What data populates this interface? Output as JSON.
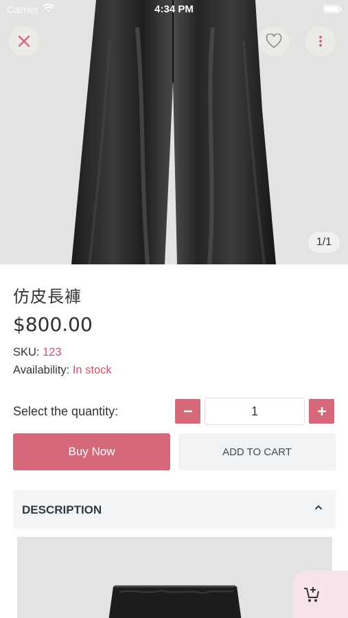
{
  "status_bar": {
    "carrier": "Carrier",
    "time": "4:34 PM"
  },
  "gallery": {
    "counter": "1/1"
  },
  "product": {
    "name": "仿皮長褲",
    "price": "$800.00",
    "sku_label": "SKU:",
    "sku_value": "123",
    "availability_label": "Availability:",
    "availability_value": "In stock"
  },
  "quantity": {
    "label": "Select the quantity:",
    "value": "1"
  },
  "actions": {
    "buy_now": "Buy Now",
    "add_to_cart": "ADD TO CART"
  },
  "description": {
    "header": "DESCRIPTION"
  },
  "colors": {
    "accent": "#d5697b",
    "accent_text": "#d4506a",
    "fab_bg": "#f8e4ea"
  }
}
